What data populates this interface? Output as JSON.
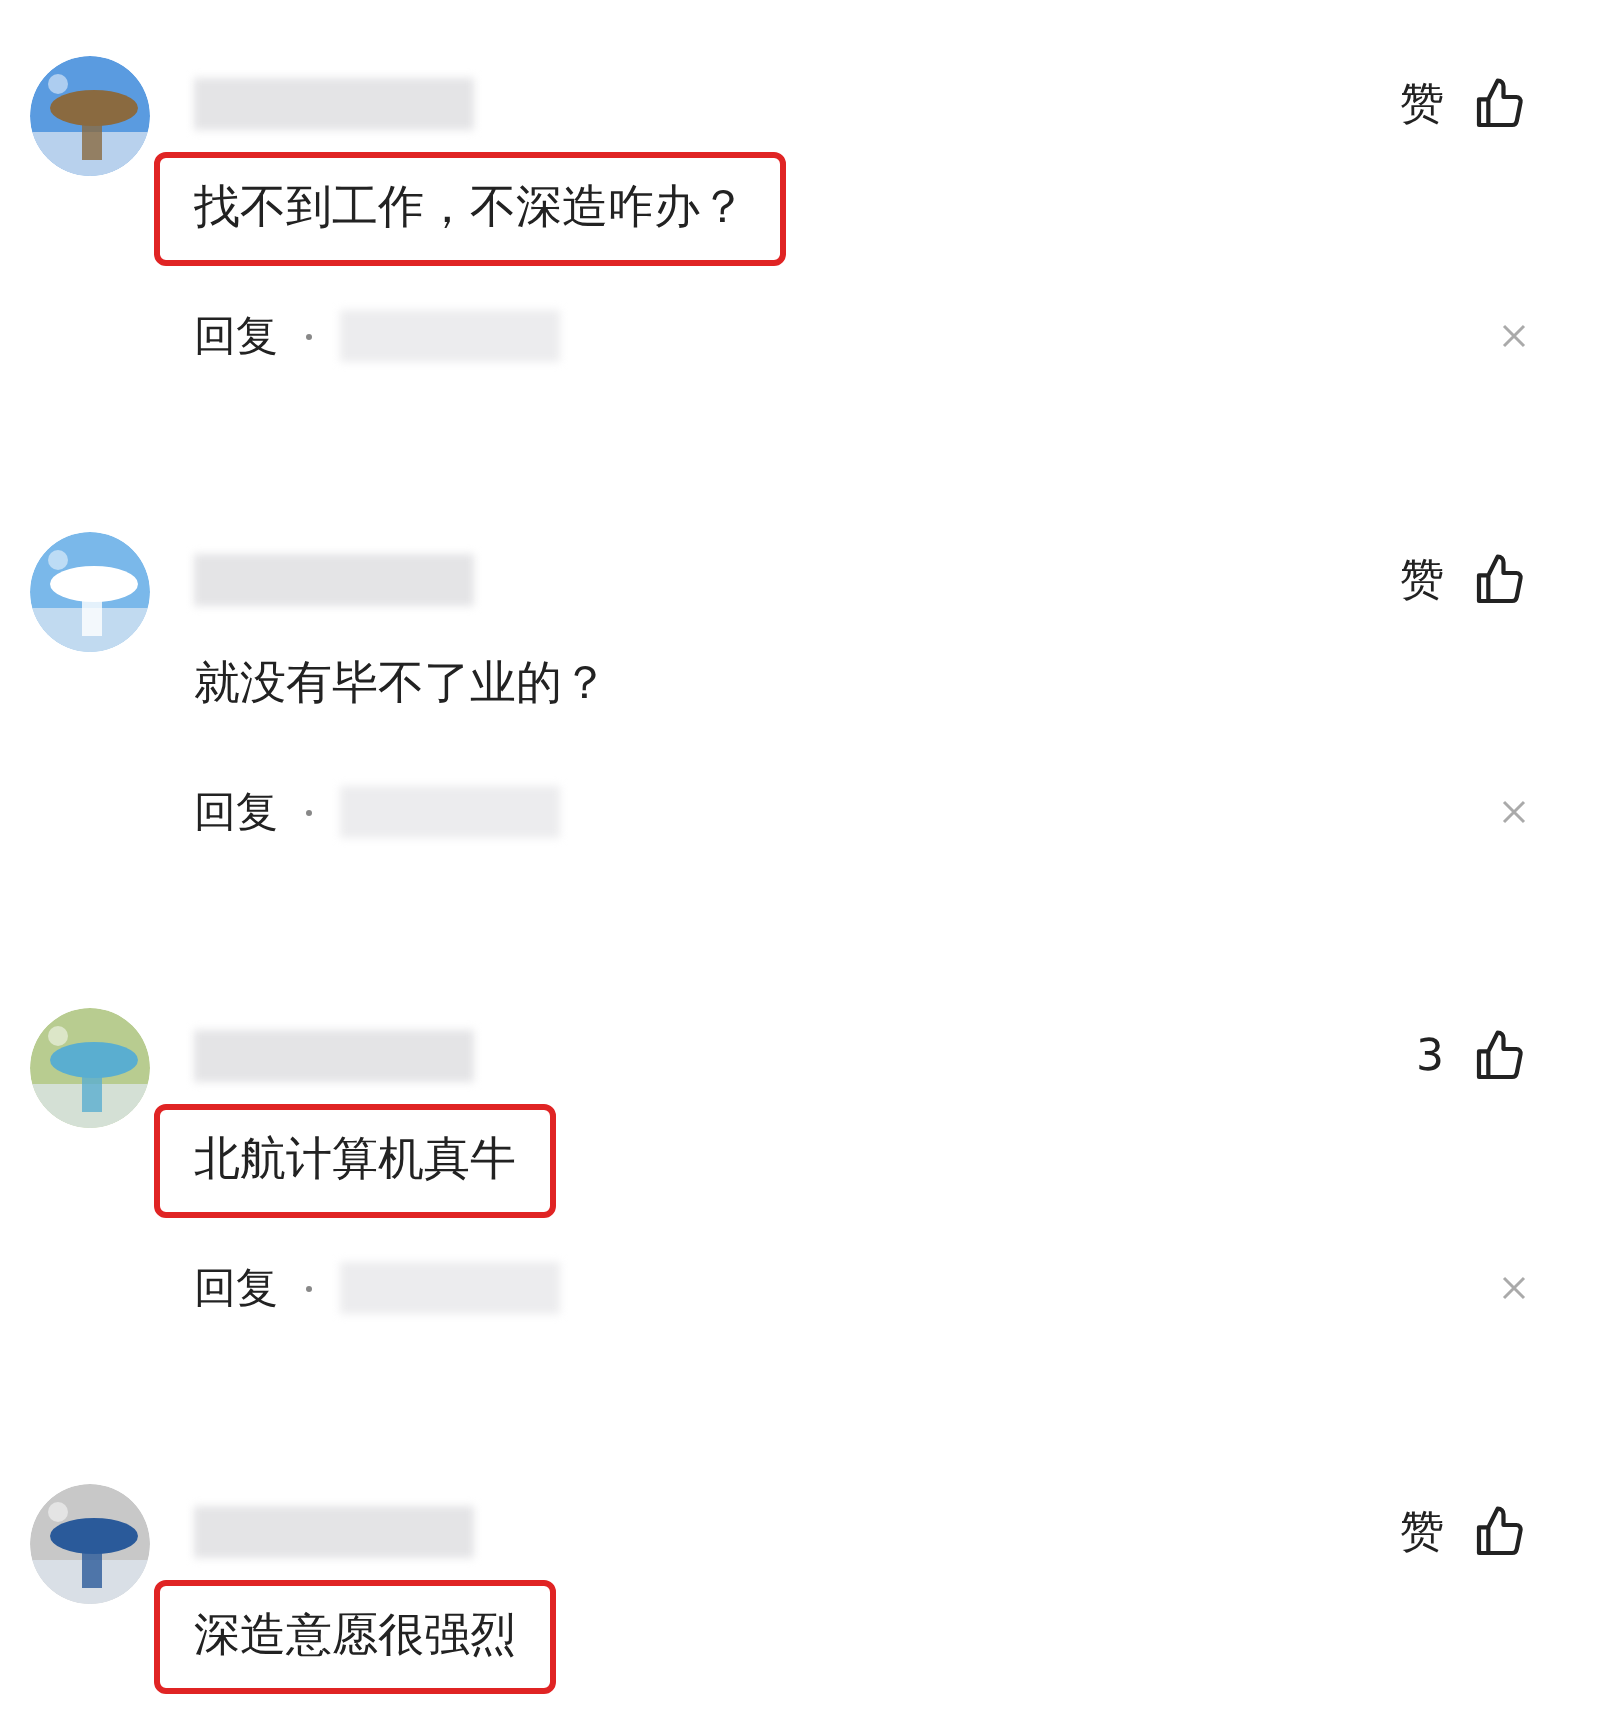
{
  "comments": [
    {
      "like_label": "赞",
      "text": "找不到工作，不深造咋办？",
      "highlighted": true,
      "reply_label": "回复"
    },
    {
      "like_label": "赞",
      "text": "就没有毕不了业的？",
      "highlighted": false,
      "reply_label": "回复"
    },
    {
      "like_label": "3",
      "text": "北航计算机真牛",
      "highlighted": true,
      "reply_label": "回复"
    },
    {
      "like_label": "赞",
      "text": "深造意愿很强烈",
      "highlighted": true
    }
  ]
}
